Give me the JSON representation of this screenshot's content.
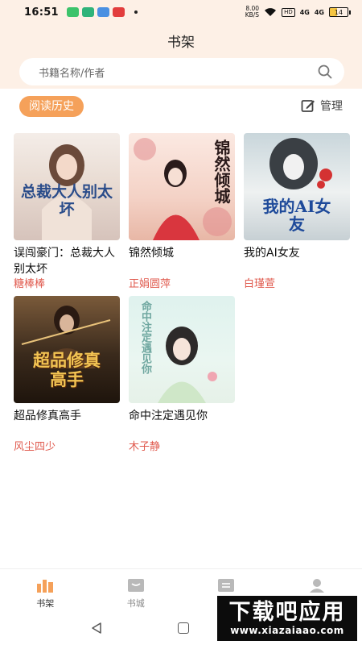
{
  "status_bar": {
    "time": "16:51",
    "net_speed_value": "8.00",
    "net_speed_unit": "KB/S",
    "hd_label": "HD",
    "signal1": "4G",
    "signal2": "4G",
    "battery": "14"
  },
  "header": {
    "title": "书架",
    "search_placeholder": "书籍名称/作者"
  },
  "section": {
    "history_label": "阅读历史",
    "manage_label": "管理"
  },
  "books": [
    {
      "title": "误闯豪门：总裁大人别太坏",
      "author": "糖棒棒",
      "cover_text": "总裁大人别太坏"
    },
    {
      "title": "锦然倾城",
      "author": "正娟圆萍",
      "cover_text": "锦然倾城"
    },
    {
      "title": "我的AI女友",
      "author": "白瑾萱",
      "cover_text": "我的AI女友"
    },
    {
      "title": "超品修真高手",
      "author": "风尘四少",
      "cover_text": "超品修真高手"
    },
    {
      "title": "命中注定遇见你",
      "author": "木子静",
      "cover_text": "命中注定遇见你"
    }
  ],
  "nav": {
    "items": [
      {
        "label": "书架",
        "icon": "bookshelf-icon",
        "active": true
      },
      {
        "label": "书城",
        "icon": "bookstore-icon",
        "active": false
      },
      {
        "label": "",
        "icon": "list-icon",
        "active": false
      },
      {
        "label": "",
        "icon": "profile-icon",
        "active": false
      }
    ]
  },
  "watermark": {
    "line1": "下载吧应用",
    "line2": "www.xiazaiaao.com"
  },
  "colors": {
    "header_bg": "#fdf0e6",
    "accent": "#f5a15a",
    "author": "#e05a4e"
  }
}
